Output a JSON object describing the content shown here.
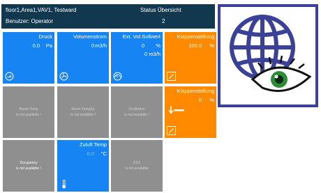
{
  "header": {
    "path": "floor1,Area1,VAV1, Testward",
    "user": "Benutzer: Operator",
    "title": "Status Übersicht",
    "count": "2"
  },
  "tiles": {
    "druck": {
      "title": "Druck",
      "value": "0.0",
      "unit": "Pa"
    },
    "volumenstrom": {
      "title": "Volumenstrom",
      "value": "0",
      "unit": "m3/h"
    },
    "ext_sollwert": {
      "title": "Ext. Vol.Sollwert",
      "value": "0",
      "unit": "%",
      "value2": "0",
      "unit2": "m3/h"
    },
    "klappenstellung1": {
      "title": "Klappenstellung",
      "value": "100.0",
      "unit": "%"
    },
    "room_temp": {
      "line1": "Room Temp",
      "line2": "is not available !"
    },
    "room_temp_sp": {
      "line1": "Room TempSp",
      "line2": "is not available !"
    },
    "occ_button": {
      "line1": "OccButton",
      "line2": "is not available !"
    },
    "klappenstellung2": {
      "title": "Klappenstellung",
      "value": "0",
      "unit": "%"
    },
    "occupancy": {
      "line1": "Occupancy",
      "line2": "is not available !"
    },
    "zuluft_temp": {
      "title": "Zuluft Temp",
      "value": "0.0",
      "unit": "°C"
    },
    "co2": {
      "line1": "CO2",
      "line2": "is not available"
    }
  },
  "colors": {
    "header": "#11384f",
    "blue": "#1684f2",
    "grey": "#8f8f8f",
    "orange": "#ff8a00",
    "logo_frame": "#3a4196"
  },
  "icons": {
    "pressure": "gauge-icon",
    "volume": "fan-icon",
    "setpoint": "dial-icon",
    "damper": "damper-edit-icon",
    "temperature": "thermometer-icon",
    "logo": "globe-eye-logo"
  }
}
